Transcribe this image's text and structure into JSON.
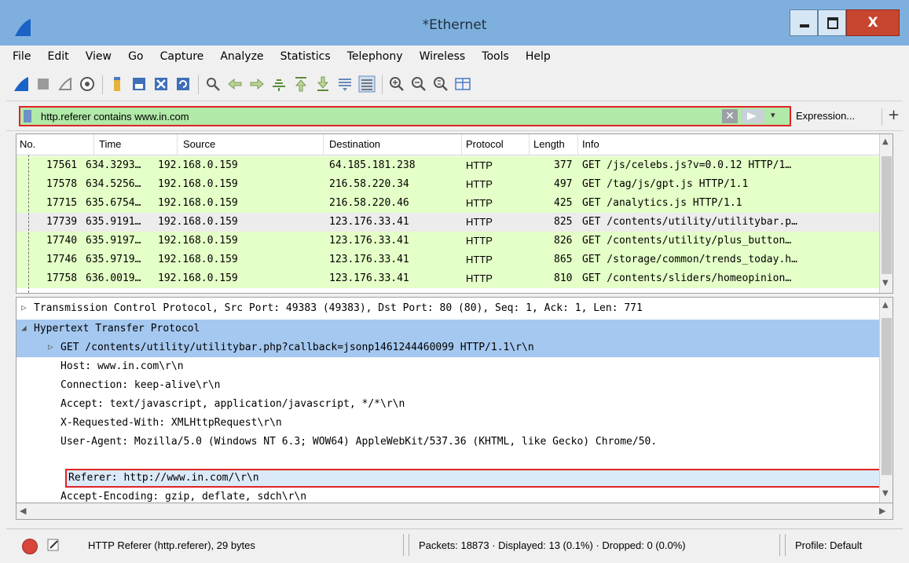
{
  "window": {
    "title": "*Ethernet",
    "close_label": "X"
  },
  "menu": [
    "File",
    "Edit",
    "View",
    "Go",
    "Capture",
    "Analyze",
    "Statistics",
    "Telephony",
    "Wireless",
    "Tools",
    "Help"
  ],
  "toolbar": {
    "icons": [
      "start-capture-icon",
      "stop-capture-icon",
      "restart-capture-icon",
      "capture-options-icon",
      "open-file-icon",
      "save-file-icon",
      "close-file-icon",
      "reload-icon",
      "find-packet-icon",
      "go-back-icon",
      "go-forward-icon",
      "go-to-packet-icon",
      "go-first-icon",
      "go-last-icon",
      "auto-scroll-icon",
      "colorize-icon",
      "zoom-in-icon",
      "zoom-out-icon",
      "zoom-normal-icon",
      "resize-columns-icon"
    ]
  },
  "filter": {
    "value": "http.referer contains www.in.com",
    "clear_label": "✕",
    "dropdown_label": "▾",
    "expression_label": "Expression...",
    "plus_label": "+"
  },
  "packet_list": {
    "headers": {
      "no": "No.",
      "time": "Time",
      "source": "Source",
      "destination": "Destination",
      "protocol": "Protocol",
      "length": "Length",
      "info": "Info"
    },
    "rows": [
      {
        "no": "17561",
        "time": "634.3293…",
        "source": "192.168.0.159",
        "destination": "64.185.181.238",
        "protocol": "HTTP",
        "length": "377",
        "info": "GET /js/celebs.js?v=0.0.12 HTTP/1…",
        "selected": false
      },
      {
        "no": "17578",
        "time": "634.5256…",
        "source": "192.168.0.159",
        "destination": "216.58.220.34",
        "protocol": "HTTP",
        "length": "497",
        "info": "GET /tag/js/gpt.js HTTP/1.1",
        "selected": false
      },
      {
        "no": "17715",
        "time": "635.6754…",
        "source": "192.168.0.159",
        "destination": "216.58.220.46",
        "protocol": "HTTP",
        "length": "425",
        "info": "GET /analytics.js HTTP/1.1",
        "selected": false
      },
      {
        "no": "17739",
        "time": "635.9191…",
        "source": "192.168.0.159",
        "destination": "123.176.33.41",
        "protocol": "HTTP",
        "length": "825",
        "info": "GET /contents/utility/utilitybar.p…",
        "selected": true
      },
      {
        "no": "17740",
        "time": "635.9197…",
        "source": "192.168.0.159",
        "destination": "123.176.33.41",
        "protocol": "HTTP",
        "length": "826",
        "info": "GET /contents/utility/plus_button…",
        "selected": false
      },
      {
        "no": "17746",
        "time": "635.9719…",
        "source": "192.168.0.159",
        "destination": "123.176.33.41",
        "protocol": "HTTP",
        "length": "865",
        "info": "GET /storage/common/trends_today.h…",
        "selected": false
      },
      {
        "no": "17758",
        "time": "636.0019…",
        "source": "192.168.0.159",
        "destination": "123.176.33.41",
        "protocol": "HTTP",
        "length": "810",
        "info": "GET /contents/sliders/homeopinion…",
        "selected": false
      }
    ]
  },
  "details": [
    {
      "expander": "▷",
      "text": "Transmission Control Protocol, Src Port: 49383 (49383), Dst Port: 80 (80), Seq: 1, Ack: 1, Len: 771",
      "highlighted": false
    },
    {
      "expander": "◢",
      "text": "Hypertext Transfer Protocol",
      "highlighted": true
    },
    {
      "expander": "▷",
      "text": "GET /contents/utility/utilitybar.php?callback=jsonp1461244460099 HTTP/1.1\\r\\n",
      "highlighted": true
    },
    {
      "expander": "",
      "text": "Host: www.in.com\\r\\n",
      "highlighted": false
    },
    {
      "expander": "",
      "text": "Connection: keep-alive\\r\\n",
      "highlighted": false
    },
    {
      "expander": "",
      "text": "Accept: text/javascript, application/javascript, */*\\r\\n",
      "highlighted": false
    },
    {
      "expander": "",
      "text": "X-Requested-With: XMLHttpRequest\\r\\n",
      "highlighted": false
    },
    {
      "expander": "",
      "text": "User-Agent: Mozilla/5.0 (Windows NT 6.3; WOW64) AppleWebKit/537.36 (KHTML, like Gecko) Chrome/50.",
      "highlighted": false
    },
    {
      "expander": "",
      "text": "Referer: http://www.in.com/\\r\\n",
      "highlighted": false
    },
    {
      "expander": "",
      "text": "Accept-Encoding: gzip, deflate, sdch\\r\\n",
      "highlighted": false
    }
  ],
  "status": {
    "field_info": "HTTP Referer (http.referer), 29 bytes",
    "packets": "Packets: 18873 · Displayed: 13 (0.1%) · Dropped: 0 (0.0%)",
    "profile": "Profile: Default"
  },
  "colors": {
    "title_bar": "#7fb0dd",
    "row_green": "#e4ffc7",
    "highlight_blue": "#a5c8f0",
    "annotation_red": "#e02424"
  }
}
